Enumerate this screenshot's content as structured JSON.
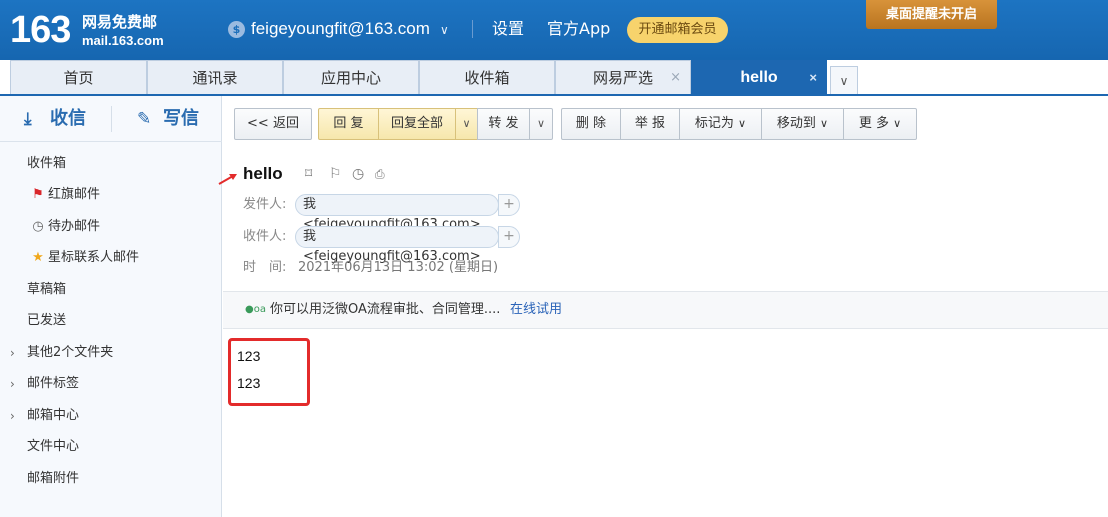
{
  "header": {
    "logo_number": "163",
    "logo_cn": "网易免费邮",
    "logo_domain": "mail.163.com",
    "account_email": "feigeyoungfit@163.com",
    "links": [
      "设置",
      "官方App"
    ],
    "vip_label": "开通邮箱会员",
    "desktop_notify_label": "桌面提醒未开启"
  },
  "tabs": [
    {
      "label": "首页"
    },
    {
      "label": "通讯录"
    },
    {
      "label": "应用中心"
    },
    {
      "label": "收件箱"
    },
    {
      "label": "网易严选",
      "closable": true
    },
    {
      "label": "hello",
      "closable": true,
      "active": true
    }
  ],
  "tab_close_glyph": "×",
  "sidebar": {
    "receive_label": "收信",
    "write_label": "写信",
    "items": [
      {
        "label": "收件箱"
      },
      {
        "label": "红旗邮件",
        "icon": "red-flag-icon"
      },
      {
        "label": "待办邮件",
        "icon": "clock-icon"
      },
      {
        "label": "星标联系人邮件",
        "icon": "star-icon"
      },
      {
        "label": "草稿箱"
      },
      {
        "label": "已发送"
      },
      {
        "label": "其他2个文件夹",
        "expandable": true
      },
      {
        "label": "邮件标签",
        "expandable": true
      },
      {
        "label": "邮箱中心",
        "expandable": true
      },
      {
        "label": "文件中心"
      },
      {
        "label": "邮箱附件"
      }
    ]
  },
  "toolbar": {
    "back": "<< 返回",
    "reply": "回 复",
    "reply_all": "回复全部",
    "forward": "转 发",
    "delete": "删 除",
    "report": "举 报",
    "mark_as": "标记为",
    "move_to": "移动到",
    "more": "更 多"
  },
  "mail": {
    "subject": "hello",
    "sender_label": "发件人:",
    "sender": "我<feigeyoungfit@163.com>",
    "recipient_label": "收件人:",
    "recipient": "我<feigeyoungfit@163.com>",
    "time_label": "时　间:",
    "time": "2021年06月13日 13:02 (星期日)",
    "oa_text": "你可以用泛微OA流程审批、合同管理....",
    "oa_link": "在线试用",
    "body_lines": [
      "123",
      "123"
    ]
  },
  "colors": {
    "header_blue": "#1a70bd",
    "active_tab": "#1d67b1",
    "vip_gold": "#f7d36c",
    "desktop_btn": "#c8842c",
    "annotation_red": "#e32b2b"
  }
}
